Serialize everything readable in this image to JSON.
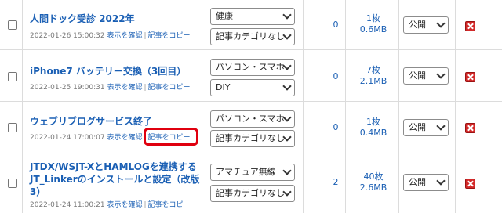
{
  "rows": [
    {
      "title": "人間ドック受診 2022年",
      "datetime": "2022-01-26 15:00:32",
      "view_link": "表示を確認",
      "copy_link": "記事をコピー",
      "category": "健康",
      "subcategory": "記事カテゴリなし",
      "comments": "0",
      "files_count": "1枚",
      "files_size": "0.6MB",
      "status": "公開"
    },
    {
      "title": "iPhone7 バッテリー交換（3回目）",
      "datetime": "2022-01-25 19:00:31",
      "view_link": "表示を確認",
      "copy_link": "記事をコピー",
      "category": "パソコン・スマホ",
      "subcategory": "DIY",
      "comments": "0",
      "files_count": "7枚",
      "files_size": "2.1MB",
      "status": "公開"
    },
    {
      "title": "ウェブリブログサービス終了",
      "datetime": "2022-01-24 17:00:07",
      "view_link": "表示を確認",
      "copy_link": "記事をコピー",
      "category": "パソコン・スマホ",
      "subcategory": "記事カテゴリなし",
      "comments": "0",
      "files_count": "1枚",
      "files_size": "0.4MB",
      "status": "公開"
    },
    {
      "title": "JTDX/WSJT-XとHAMLOGを連携するJT_Linkerのインストールと設定（改版3）",
      "datetime": "2022-01-24 11:00:21",
      "view_link": "表示を確認",
      "copy_link": "記事をコピー",
      "category": "アマチュア無線",
      "subcategory": "記事カテゴリなし",
      "comments": "2",
      "files_count": "40枚",
      "files_size": "2.6MB",
      "status": "公開"
    }
  ],
  "colors": {
    "link": "#1a5fb4",
    "highlight": "#e0000f",
    "delete": "#d32a2a"
  }
}
